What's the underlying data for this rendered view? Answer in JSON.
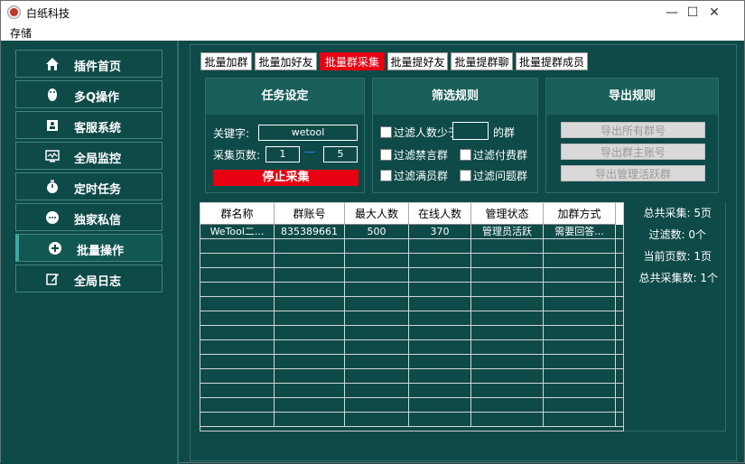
{
  "window": {
    "title": "白纸科技",
    "minimize": "—",
    "maximize": "☐",
    "close": "✕"
  },
  "menu": {
    "storage": "存储"
  },
  "sidebar": {
    "items": [
      {
        "label": "插件首页",
        "icon": "home-icon"
      },
      {
        "label": "多Q操作",
        "icon": "penguin-icon"
      },
      {
        "label": "客服系统",
        "icon": "user-card-icon"
      },
      {
        "label": "全局监控",
        "icon": "monitor-icon"
      },
      {
        "label": "定时任务",
        "icon": "timer-icon"
      },
      {
        "label": "独家私信",
        "icon": "chat-dots-icon"
      },
      {
        "label": "批量操作",
        "icon": "plus-circle-icon",
        "active": true
      },
      {
        "label": "全局日志",
        "icon": "edit-log-icon"
      }
    ]
  },
  "tabs": [
    "批量加群",
    "批量加好友",
    "批量群采集",
    "批量提好友",
    "批量提群聊",
    "批量提群成员"
  ],
  "active_tab": 2,
  "task": {
    "title": "任务设定",
    "keyword_label": "关键字:",
    "keyword_value": "wetool",
    "pages_label": "采集页数:",
    "page_from": "1",
    "page_to": "5",
    "dash": "—",
    "stop_button": "停止采集"
  },
  "filter": {
    "title": "筛选规则",
    "min_members_label": "过滤人数少于",
    "min_members_value": "",
    "group_suffix": "的群",
    "mute_label": "过滤禁言群",
    "paid_label": "过滤付费群",
    "full_label": "过滤满员群",
    "question_label": "过滤问题群"
  },
  "export": {
    "title": "导出规则",
    "all_groups": "导出所有群号",
    "owner": "导出群主账号",
    "active_admin": "导出管理活跃群"
  },
  "table": {
    "columns": [
      "群名称",
      "群账号",
      "最大人数",
      "在线人数",
      "管理状态",
      "加群方式"
    ],
    "rows": [
      [
        "WeTool二...",
        "835389661",
        "500",
        "370",
        "管理员活跃",
        "需要回答..."
      ]
    ]
  },
  "stats": {
    "total_collected": "总共采集: 5页",
    "filtered": "过滤数: 0个",
    "current_page": "当前页数: 1页",
    "total_groups": "总共采集数: 1个"
  },
  "colors": {
    "bg": "#0e4a48",
    "accent": "#e60012",
    "panel_head": "#195e5a"
  }
}
